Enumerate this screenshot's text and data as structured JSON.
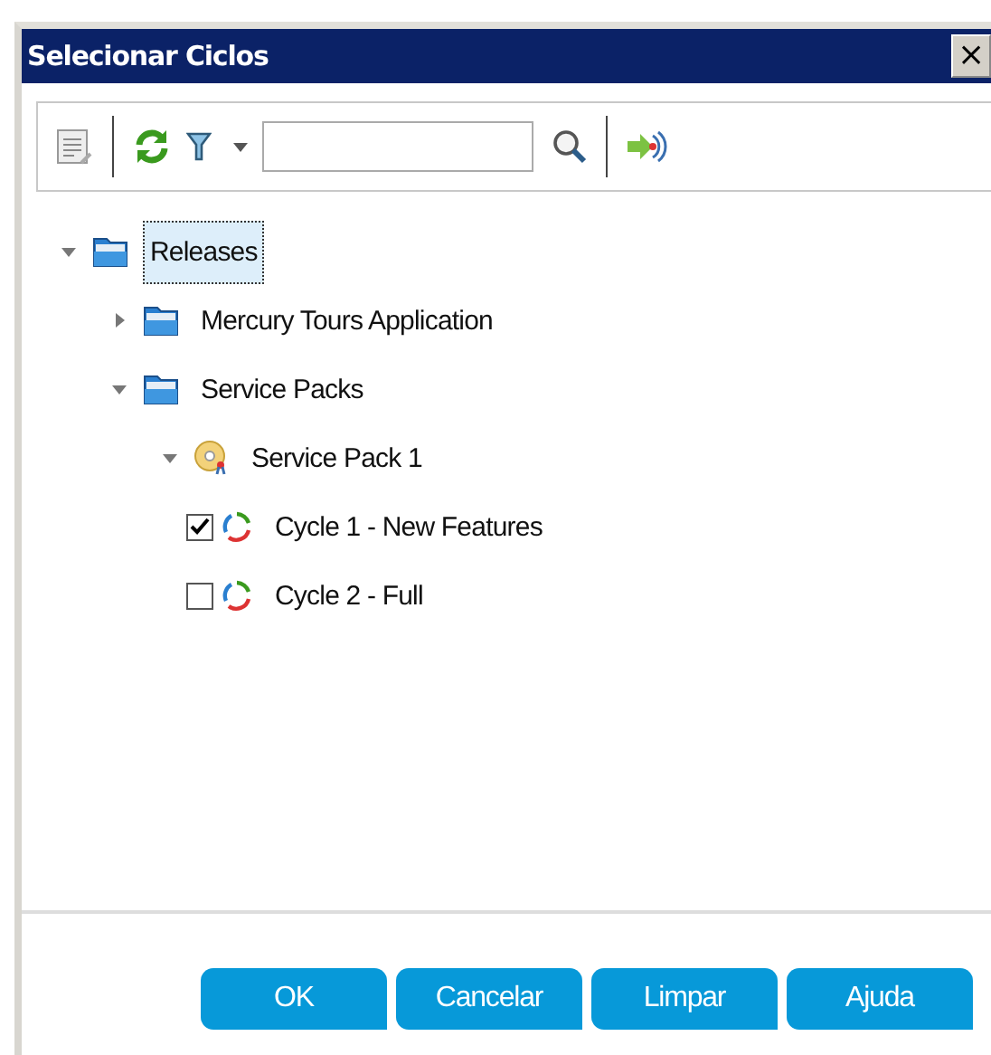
{
  "window": {
    "title": "Selecionar Ciclos",
    "close": "×"
  },
  "tree": [
    {
      "label": "Releases",
      "kind": "folder",
      "expanded": true,
      "selected": true,
      "children": [
        {
          "label": "Mercury Tours Application",
          "kind": "folder",
          "expanded": false,
          "selected": false
        },
        {
          "label": "Service Packs",
          "kind": "folder",
          "expanded": true,
          "selected": false,
          "children": [
            {
              "label": "Service Pack 1",
              "kind": "release",
              "expanded": true,
              "selected": false,
              "children": [
                {
                  "label": "Cycle 1 - New Features",
                  "kind": "cycle",
                  "checked": true,
                  "selected": false
                },
                {
                  "label": "Cycle 2 - Full",
                  "kind": "cycle",
                  "checked": false,
                  "selected": false
                }
              ]
            }
          ]
        }
      ]
    }
  ],
  "buttons": [
    "OK",
    "Cancelar",
    "Limpar",
    "Ajuda"
  ]
}
